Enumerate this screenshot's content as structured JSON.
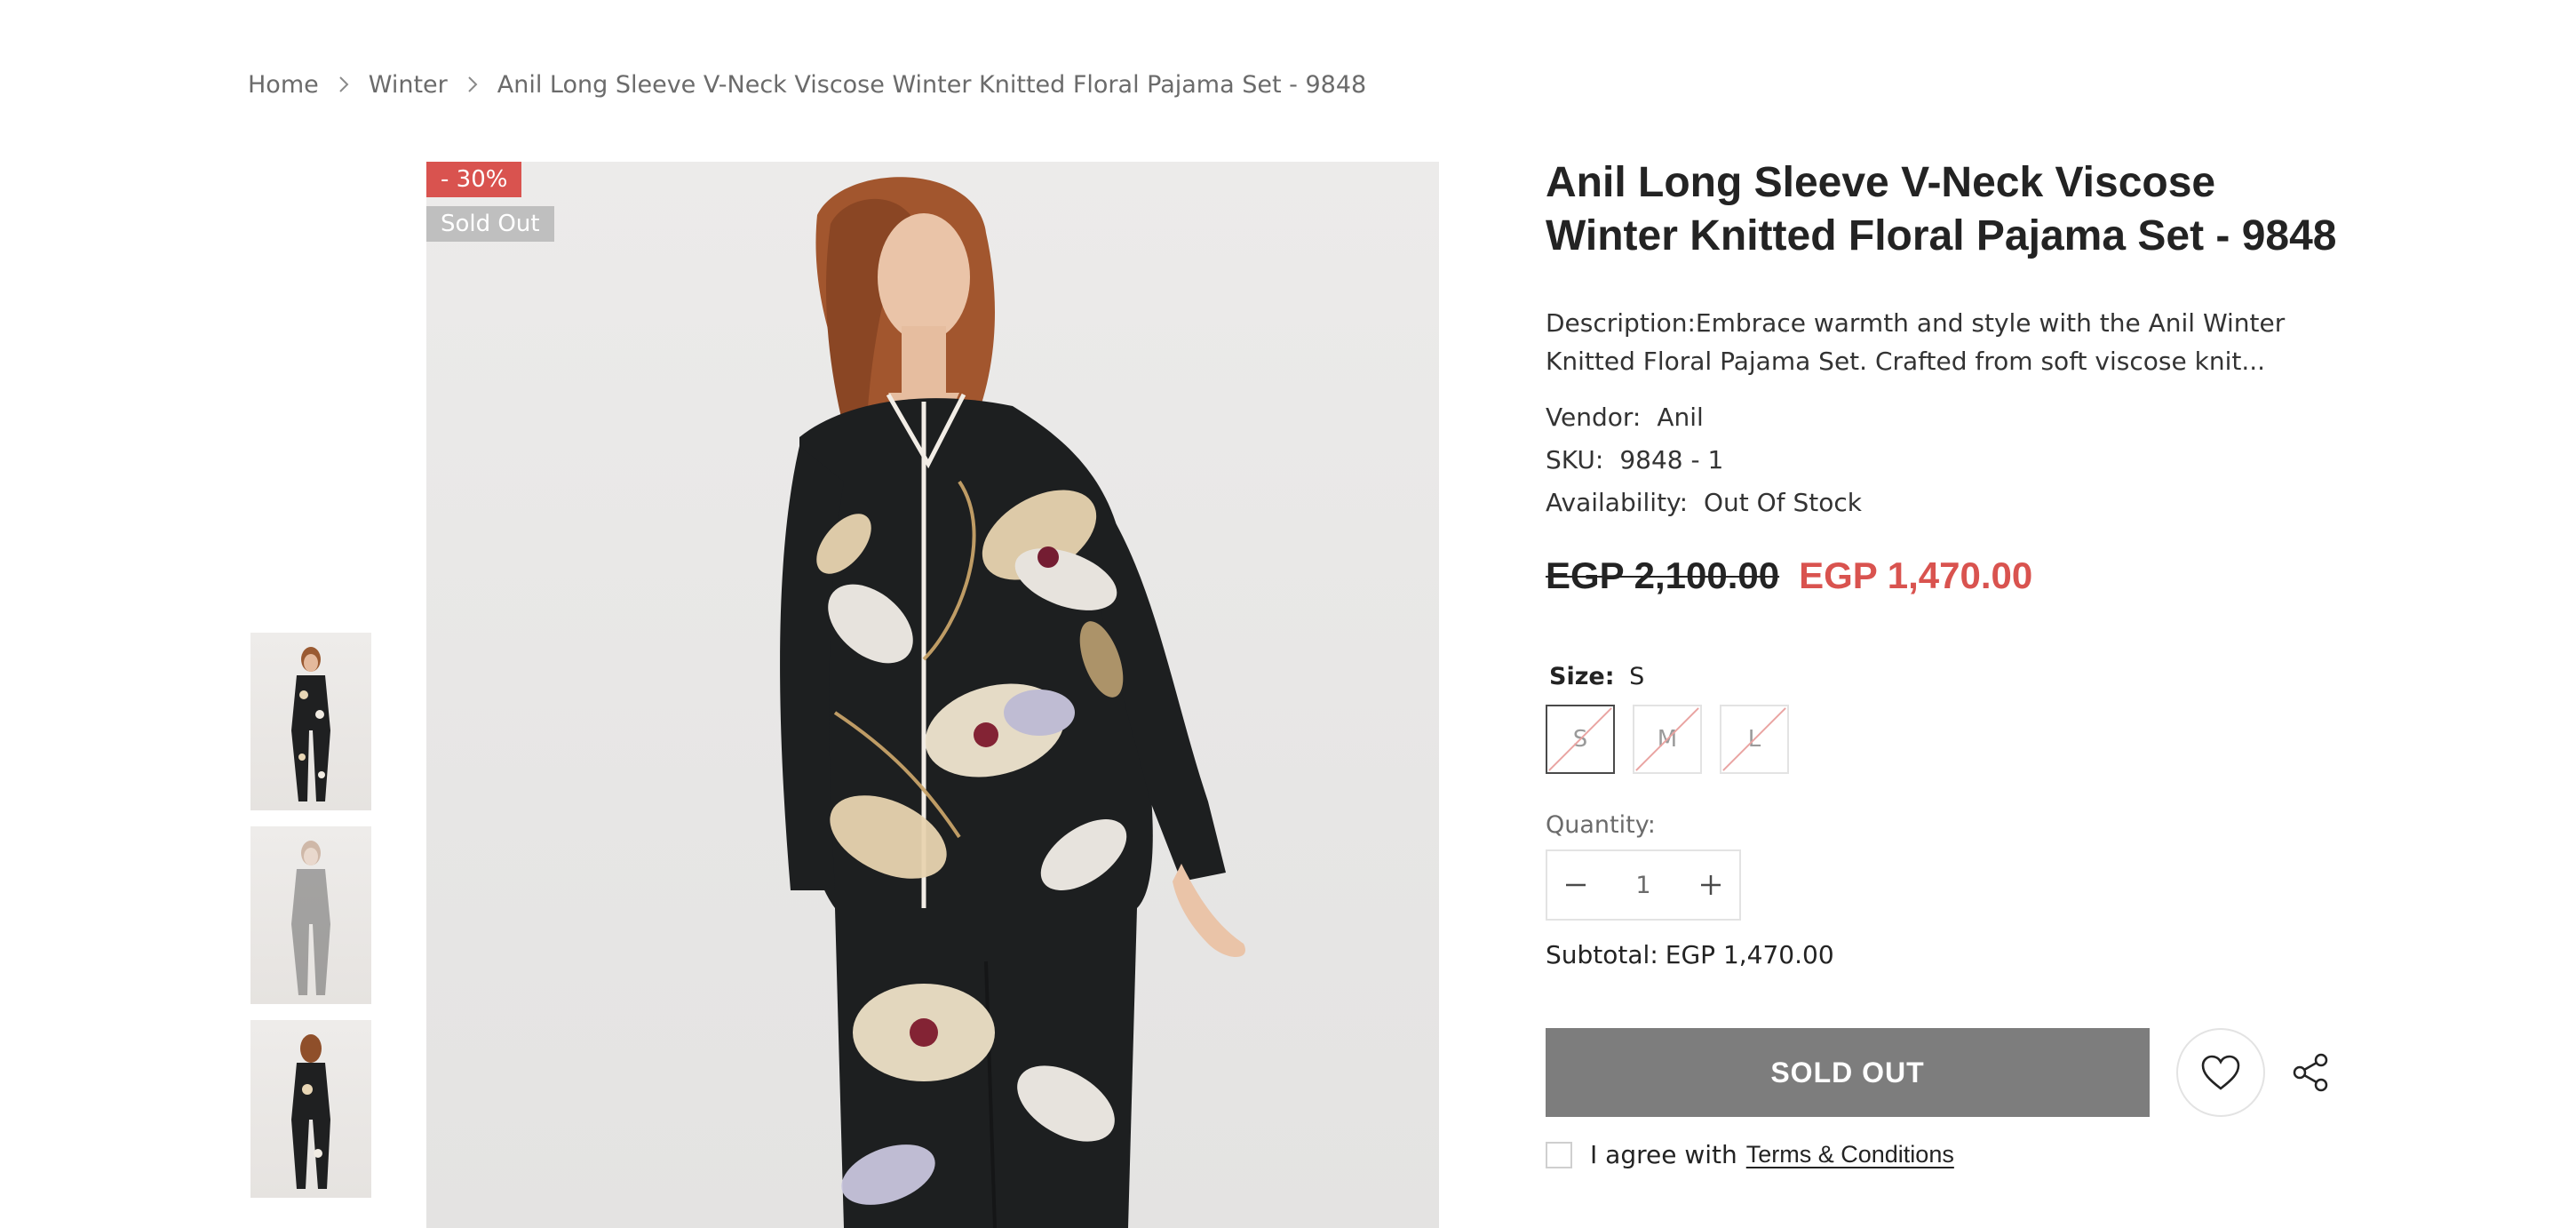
{
  "breadcrumb": {
    "home": "Home",
    "category": "Winter",
    "current": "Anil Long Sleeve V-Neck Viscose Winter Knitted Floral Pajama Set - 9848"
  },
  "gallery": {
    "sale_badge": "- 30%",
    "sold_badge": "Sold Out",
    "thumbnails": [
      "front view",
      "front view (faded)",
      "back view"
    ]
  },
  "product": {
    "title": "Anil Long Sleeve V-Neck Viscose Winter Knitted Floral Pajama Set - 9848",
    "description": "Description:Embrace warmth and style with the Anil Winter Knitted Floral Pajama Set. Crafted from soft viscose knit...",
    "vendor_label": "Vendor:",
    "vendor": "Anil",
    "sku_label": "SKU:",
    "sku": "9848 - 1",
    "availability_label": "Availability:",
    "availability": "Out Of Stock",
    "price_old": "EGP 2,100.00",
    "price_new": "EGP 1,470.00",
    "size_label": "Size:",
    "size_selected": "S",
    "sizes": [
      "S",
      "M",
      "L"
    ],
    "quantity_label": "Quantity:",
    "quantity": "1",
    "subtotal_label": "Subtotal:",
    "subtotal": "EGP 1,470.00",
    "sold_out_button": "SOLD OUT",
    "agree_text": "I agree with",
    "terms_link": "Terms & Conditions"
  },
  "colors": {
    "sale_red": "#d9534f",
    "sold_button": "#7d7d7d",
    "badge_gray": "#bfbfbf"
  },
  "icons": [
    "chevron-right-icon",
    "minus-icon",
    "plus-icon",
    "heart-icon",
    "share-icon"
  ]
}
